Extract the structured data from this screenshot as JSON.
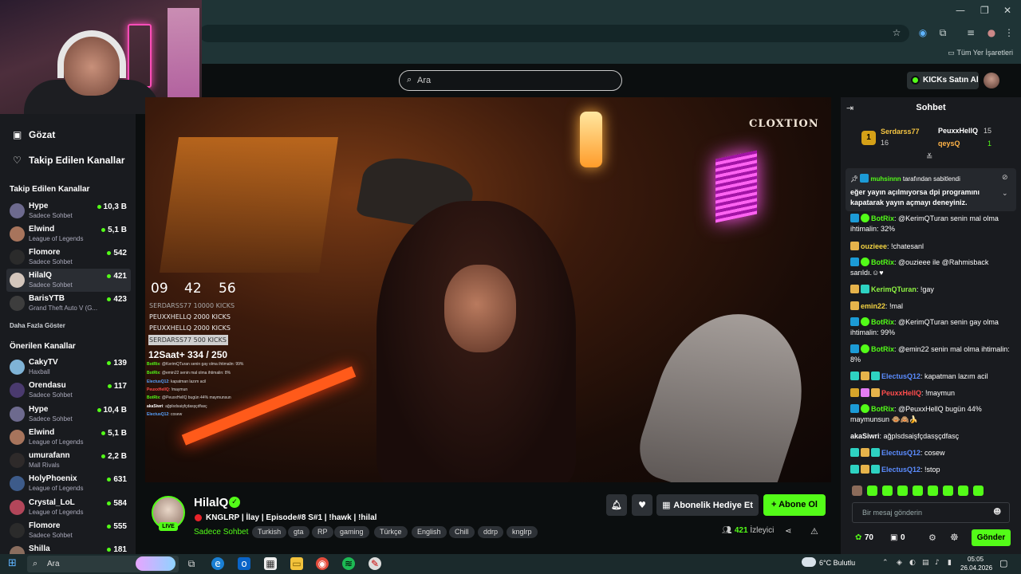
{
  "browser": {
    "bookmarks_label": "Tüm Yer İşaretleri",
    "window_controls": [
      "—",
      "❐",
      "✕"
    ]
  },
  "header": {
    "search_placeholder": "Ara",
    "kicks_button": "KICKs Satın Al"
  },
  "sidebar": {
    "nav": [
      {
        "label": "Gözat",
        "icon": "browse-icon"
      },
      {
        "label": "Takip Edilen Kanallar",
        "icon": "heart-icon"
      }
    ],
    "followed_title": "Takip Edilen Kanallar",
    "followed": [
      {
        "name": "Hype",
        "category": "Sadece Sohbet",
        "viewers": "10,3 B"
      },
      {
        "name": "Elwind",
        "category": "League of Legends",
        "viewers": "5,1 B"
      },
      {
        "name": "Flomore",
        "category": "Sadece Sohbet",
        "viewers": "542"
      },
      {
        "name": "HilalQ",
        "category": "Sadece Sohbet",
        "viewers": "421"
      },
      {
        "name": "BarisYTB",
        "category": "Grand Theft Auto V (G...",
        "viewers": "423"
      }
    ],
    "show_more": "Daha Fazla Göster",
    "recommended_title": "Önerilen Kanallar",
    "recommended": [
      {
        "name": "CakyTV",
        "category": "Haxball",
        "viewers": "139"
      },
      {
        "name": "Orendasu",
        "category": "Sadece Sohbet",
        "viewers": "117"
      },
      {
        "name": "Hype",
        "category": "Sadece Sohbet",
        "viewers": "10,4 B"
      },
      {
        "name": "Elwind",
        "category": "League of Legends",
        "viewers": "5,1 B"
      },
      {
        "name": "umurafann",
        "category": "Mall Rivals",
        "viewers": "2,2 B"
      },
      {
        "name": "HolyPhoenix",
        "category": "League of Legends",
        "viewers": "631"
      },
      {
        "name": "Crystal_LoL",
        "category": "League of Legends",
        "viewers": "584"
      },
      {
        "name": "Flomore",
        "category": "Sadece Sohbet",
        "viewers": "555"
      },
      {
        "name": "Shilla",
        "category": "",
        "viewers": "181"
      }
    ]
  },
  "video": {
    "watermark": "CLOXTION",
    "timer": [
      "09",
      "42",
      "56"
    ],
    "kick_leaders": [
      "SERDARSS77  10000 KICKS",
      "PEUXXHELLQ  2000 KICKS",
      "PEUXXHELLQ  2000 KICKS",
      "SERDARSS77  500 KICKS"
    ],
    "sub_goal": "12Saat+ 334 / 250",
    "overlay_chat": [
      {
        "user": "BotRix",
        "text": ": @KerimQTuran senin gay olma ihtimalin: 99%"
      },
      {
        "user": "BotRix",
        "text": ": @emin22 senin mal olma ihtimalin: 8%"
      },
      {
        "user": "ElectusQ12",
        "text": ": kapatman lazım acil"
      },
      {
        "user": "PeuxxHellQ",
        "text": ": !maymun"
      },
      {
        "user": "BotRix",
        "text": ": @PeuxxHellQ bugün 44% maymunsun"
      },
      {
        "user": "akaSiwri",
        "text": ": ağplsdsaişfçdasşçdfasç"
      },
      {
        "user": "ElectusQ12",
        "text": ": cosew"
      }
    ]
  },
  "stream": {
    "name": "HilalQ",
    "live_label": "LIVE",
    "title": "KNGLRP | İlay | Episode#8 S#1 | !hawk | !hilal",
    "category": "Sadece Sohbet",
    "tags": [
      "Turkish",
      "gta",
      "RP",
      "gaming",
      "Türkçe",
      "English",
      "Chill",
      "ddrp",
      "knglrp"
    ],
    "gift_sub_label": "Abonelik Hediye Et",
    "subscribe_label": "Abone Ol",
    "viewers": "421",
    "viewers_label": "İzleyici"
  },
  "chat": {
    "title": "Sohbet",
    "leaderboard": [
      {
        "rank": "1",
        "name": "Serdarss77",
        "value": "16"
      },
      {
        "name": "PeuxxHellQ",
        "value": "15"
      },
      {
        "name": "qeysQ",
        "value": "1"
      }
    ],
    "pinned_by": "muhsinnn",
    "pinned_suffix": "tarafından sabitlendi",
    "pinned_text": "eğer yayın açılmıyorsa dpi programını kapatarak yayın açmayı deneyiniz.",
    "messages": [
      {
        "user": "BotRix",
        "text": "@KerimQTuran senin mal olma ihtimalin: 32%"
      },
      {
        "user": "ouzieee",
        "text": "!chatesanl"
      },
      {
        "user": "BotRix",
        "text": "@ouzieee ile @Rahmisback sarıldı.☺♥"
      },
      {
        "user": "KerimQTuran",
        "text": "!gay"
      },
      {
        "user": "emin22",
        "text": "!mal"
      },
      {
        "user": "BotRix",
        "text": "@KerimQTuran senin gay olma ihtimalin: 99%"
      },
      {
        "user": "BotRix",
        "text": "@emin22 senin mal olma ihtimalin: 8%"
      },
      {
        "user": "ElectusQ12",
        "text": "kapatman lazım acil"
      },
      {
        "user": "PeuxxHellQ",
        "text": "!maymun"
      },
      {
        "user": "BotRix",
        "text": "@PeuxxHellQ bugün 44% maymunsun 🐵🙈🍌"
      },
      {
        "user": "akaSiwri",
        "text": "ağplsdsaişfçdasşçdfasç"
      },
      {
        "user": "ElectusQ12",
        "text": "cosew"
      },
      {
        "user": "ElectusQ12",
        "text": "!stop"
      }
    ],
    "input_placeholder": "Bir mesaj gönderin",
    "points": "70",
    "kicks": "0",
    "send_label": "Gönder"
  },
  "taskbar": {
    "search_label": "Ara",
    "weather": "6°C Bulutlu",
    "time": "05:05",
    "date": "26.04.2026"
  }
}
